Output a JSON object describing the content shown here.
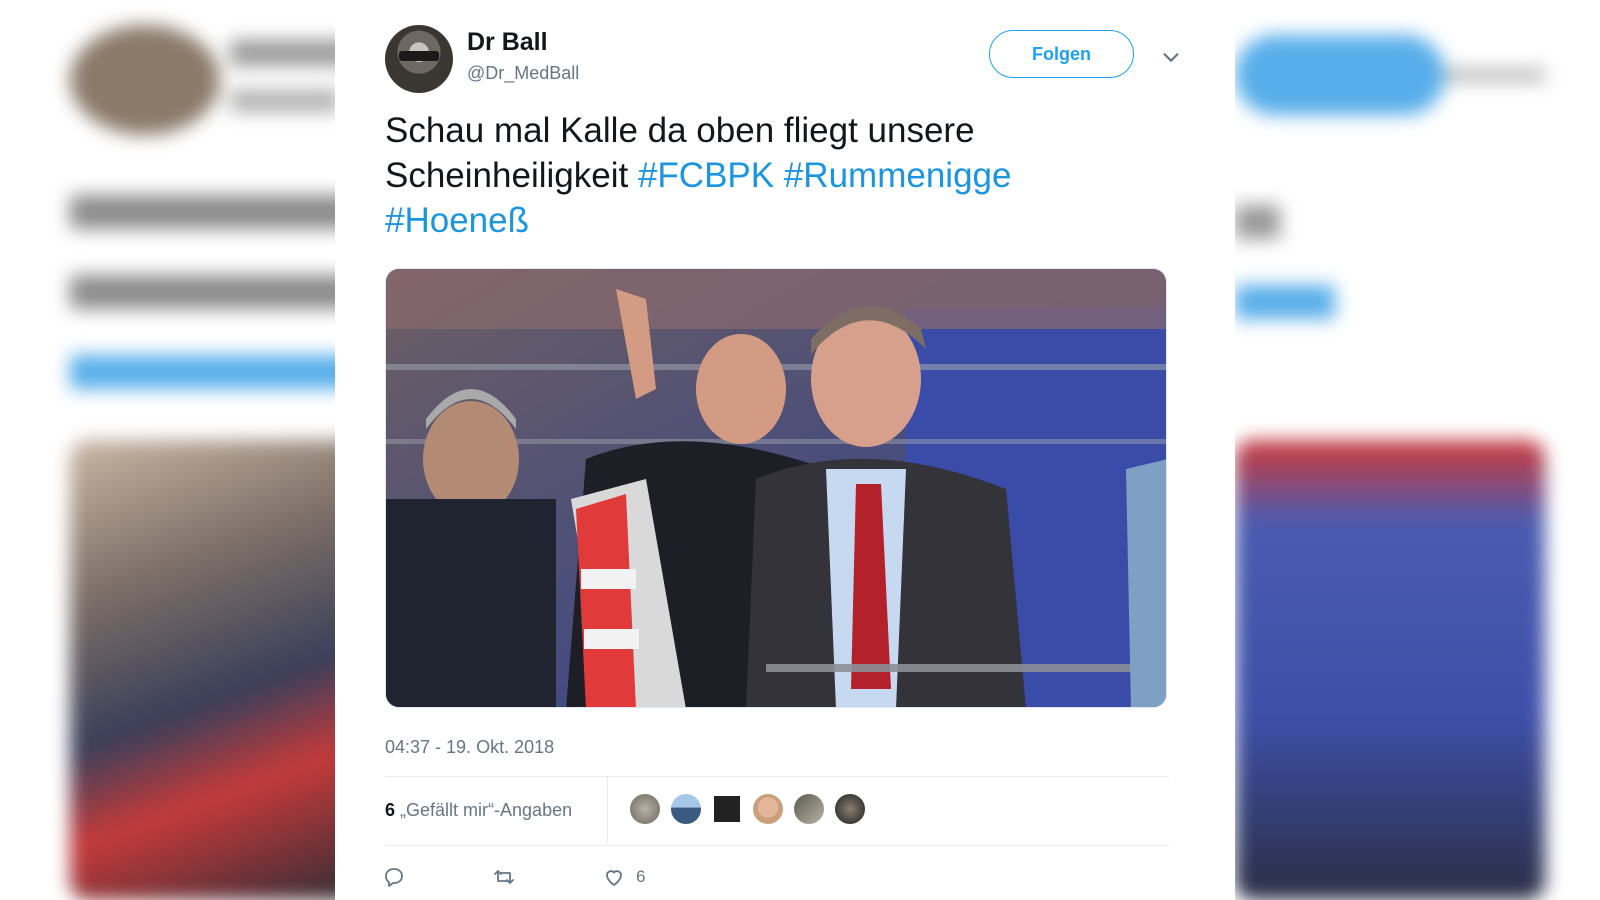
{
  "tweet": {
    "author_name": "Dr Ball",
    "author_handle": "@Dr_MedBall",
    "follow_label": "Folgen",
    "text_plain": "Schau mal Kalle da oben fliegt unsere Scheinheiligkeit",
    "hashtags": [
      "#FCBPK",
      "#Rummenigge",
      "#Hoeneß"
    ],
    "timestamp": "04:37 - 19. Okt. 2018",
    "likes_count": "6",
    "likes_label": "„Gefällt mir“-Angaben",
    "like_action_count": "6"
  },
  "colors": {
    "accent": "#1da1f2",
    "hashtag": "#1b95e0",
    "text": "#14171a",
    "muted": "#657786"
  },
  "icons": {
    "reply": "reply-icon",
    "retweet": "retweet-icon",
    "like": "heart-icon",
    "menu": "chevron-down-icon"
  }
}
